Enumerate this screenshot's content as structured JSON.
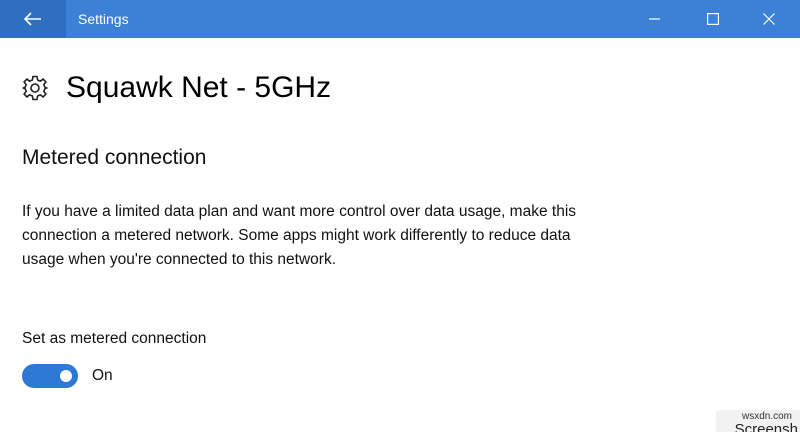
{
  "window": {
    "title": "Settings"
  },
  "network": {
    "name": "Squawk Net - 5GHz"
  },
  "metered": {
    "section_title": "Metered connection",
    "description": "If you have a limited data plan and want more control over data usage, make this connection a metered network. Some apps might work differently to reduce data usage when you're connected to this network.",
    "toggle_label": "Set as metered connection",
    "toggle_state": "On",
    "toggle_on": true
  },
  "watermark": {
    "site": "wsxdn.com",
    "partial_text": "Screensh"
  },
  "colors": {
    "titlebar": "#3c81d6",
    "back_button": "#2f6fc1",
    "toggle_accent": "#2d78d4"
  },
  "icons": {
    "back": "back-arrow-icon",
    "minimize": "minimize-icon",
    "maximize": "maximize-icon",
    "close": "close-icon",
    "settings": "gear-icon"
  }
}
